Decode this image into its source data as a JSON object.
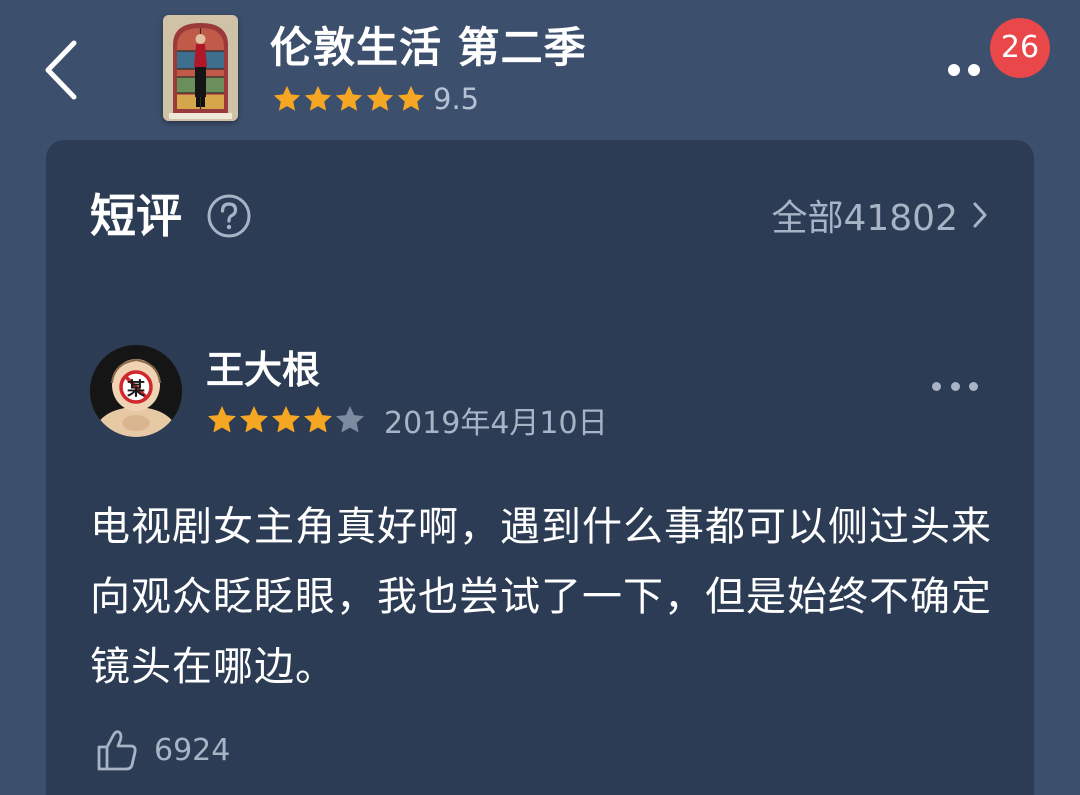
{
  "header": {
    "title": "伦敦生活 第二季",
    "rating_score": "9.5",
    "rating_stars": 5,
    "notification_count": "26"
  },
  "reviews_section": {
    "title": "短评",
    "all_link_label": "全部41802"
  },
  "review": {
    "username": "王大根",
    "avatar_badge_text": "某",
    "rating_stars": 4,
    "date": "2019年4月10日",
    "text": "电视剧女主角真好啊，遇到什么事都可以侧过头来向观众眨眨眼，我也尝试了一下，但是始终不确定镜头在哪边。",
    "like_count": "6924"
  },
  "colors": {
    "background": "#3c4f6d",
    "card": "#2c3c55",
    "star_filled": "#f5a623",
    "star_empty": "#7d8aa0",
    "badge": "#e9474a"
  }
}
